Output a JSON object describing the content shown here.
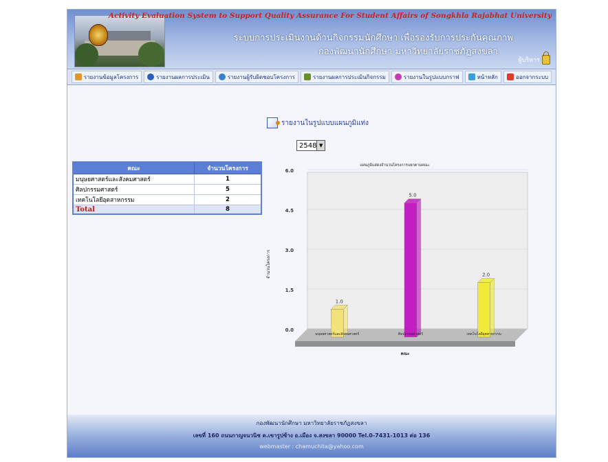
{
  "header": {
    "english_title": "Activity Evaluation System to Support Quality Assurance For Student Affairs of Songkhla Rajabhat University",
    "thai_title_1": "ระบบการประเมินงานด้านกิจกรรมนักศึกษา เพื่อรองรับการประกันคุณภาพ",
    "thai_title_2": "กองพัฒนานักศึกษา มหาวิทยาลัยราชภัฏสงขลา",
    "login_label": "ผู้บริหาร"
  },
  "nav": {
    "items": [
      {
        "label": "รายงานข้อมูลโครงการ",
        "icon": "report-icon",
        "color": "#e0962a"
      },
      {
        "label": "รายงานผลการประเมิน",
        "icon": "globe-icon",
        "color": "#2e5fb8"
      },
      {
        "label": "รายงานผู้รับผิดชอบโครงการ",
        "icon": "people-icon",
        "color": "#3a7fd0"
      },
      {
        "label": "รายงานผลการประเมินกิจกรรม",
        "icon": "chart-icon",
        "color": "#6a8f2a"
      },
      {
        "label": "รายงานในรูปแบบกราฟ",
        "icon": "pie-icon",
        "color": "#c83ab0"
      },
      {
        "label": "หน้าหลัก",
        "icon": "home-icon",
        "color": "#3a9fd8"
      },
      {
        "label": "ออกจากระบบ",
        "icon": "close-icon",
        "color": "#e03a2a"
      }
    ]
  },
  "report": {
    "title": "รายงานในรูปแบบแผนภูมิแท่ง",
    "year_selected": "2548"
  },
  "table": {
    "headers": [
      "คณะ",
      "จำนวนโครงการ"
    ],
    "rows": [
      {
        "faculty": "มนุษยศาสตร์และสังคมศาสตร์",
        "count": "1"
      },
      {
        "faculty": "ศิลปกรรมศาสตร์",
        "count": "5"
      },
      {
        "faculty": "เทคโนโลยีอุตสาหกรรม",
        "count": "2"
      }
    ],
    "total_label": "Total",
    "total_value": "8"
  },
  "chart_data": {
    "type": "bar",
    "title": "แผนภูมิแสดงจำนวนโครงการแยกตามคณะ",
    "xlabel": "คณะ",
    "ylabel": "จำนวนโครงการ",
    "categories": [
      "มนุษยศาสตร์และสังคมศาสตร์",
      "ศิลปกรรมศาสตร์",
      "เทคโนโลยีอุตสาหกรรม"
    ],
    "values": [
      1,
      5,
      2
    ],
    "value_labels": [
      "1.0",
      "5.0",
      "2.0"
    ],
    "y_ticks": [
      "0.0",
      "1.5",
      "3.0",
      "4.5",
      "6.0"
    ],
    "ylim": [
      0,
      6
    ],
    "colors": [
      "#f3e27a",
      "#c21ec1",
      "#f2ea3a"
    ],
    "grid": true
  },
  "footer": {
    "line1": "กองพัฒนานักศึกษา มหาวิทยาลัยราชภัฏสงขลา",
    "line2": "เลขที่ 160 ถนนกาญจนวนิช ต.เขารูปช้าง อ.เมือง จ.สงขลา 90000 Tel.0-7431-1013 ต่อ 136",
    "line3": "webmaster : chamuchita@yahoo.com"
  }
}
